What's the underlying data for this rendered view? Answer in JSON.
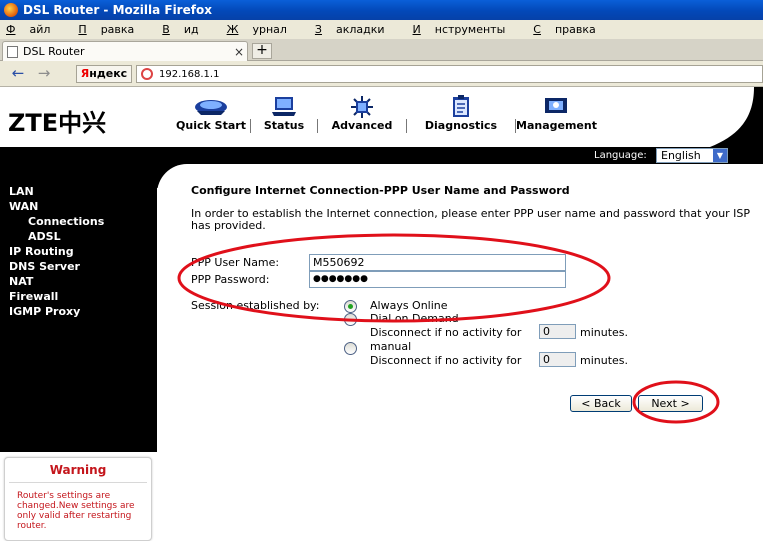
{
  "browser": {
    "window_title": "DSL Router - Mozilla Firefox",
    "menu": [
      {
        "label": "Файл",
        "u": "Ф",
        "rest": "айл"
      },
      {
        "label": "Правка",
        "u": "П",
        "rest": "равка"
      },
      {
        "label": "Вид",
        "u": "В",
        "rest": "ид"
      },
      {
        "label": "Журнал",
        "u": "Ж",
        "rest": "урнал"
      },
      {
        "label": "Закладки",
        "u": "З",
        "rest": "акладки"
      },
      {
        "label": "Инструменты",
        "u": "И",
        "rest": "нструменты"
      },
      {
        "label": "Справка",
        "u": "С",
        "rest": "правка"
      }
    ],
    "tab_title": "DSL Router",
    "tab_close": "×",
    "new_tab": "+",
    "back_glyph": "←",
    "forward_glyph": "→",
    "yandex_first": "Я",
    "yandex_rest": "ндекс",
    "url": "192.168.1.1"
  },
  "router": {
    "logo": "ZTE中兴",
    "nav": [
      {
        "label": "Quick Start",
        "icon": "quick-start-icon"
      },
      {
        "label": "Status",
        "icon": "status-icon"
      },
      {
        "label": "Advanced",
        "icon": "advanced-icon"
      },
      {
        "label": "Diagnostics",
        "icon": "diagnostics-icon"
      },
      {
        "label": "Management",
        "icon": "management-icon"
      }
    ],
    "language_label": "Language:",
    "language_value": "English"
  },
  "sidebar": {
    "items": [
      "LAN",
      "WAN",
      "Connections",
      "ADSL",
      "IP Routing",
      "DNS Server",
      "NAT",
      "Firewall",
      "IGMP Proxy"
    ]
  },
  "warning": {
    "title": "Warning",
    "text": "Router's settings are changed.New settings are only valid after restarting router."
  },
  "main": {
    "title": "Configure Internet Connection-PPP User Name and Password",
    "intro": "In order to establish the Internet connection, please enter PPP user name and password that your ISP has provided.",
    "username_label": "PPP User Name:",
    "username_value": "M550692",
    "password_label": "PPP Password:",
    "password_value": "●●●●●●●",
    "session_label": "Session established by:",
    "opt_always": "Always Online",
    "opt_demand": "Dial on Demand",
    "disconnect_text": "Disconnect if no activity for",
    "demand_minutes": "0",
    "opt_manual": "manual",
    "manual_minutes": "0",
    "minutes_label": "minutes.",
    "back_label": "< Back",
    "next_label": "Next >"
  },
  "colors": {
    "annotation": "#e0101a",
    "warning_text": "#c4161c",
    "radio_checked": "#21a121"
  }
}
